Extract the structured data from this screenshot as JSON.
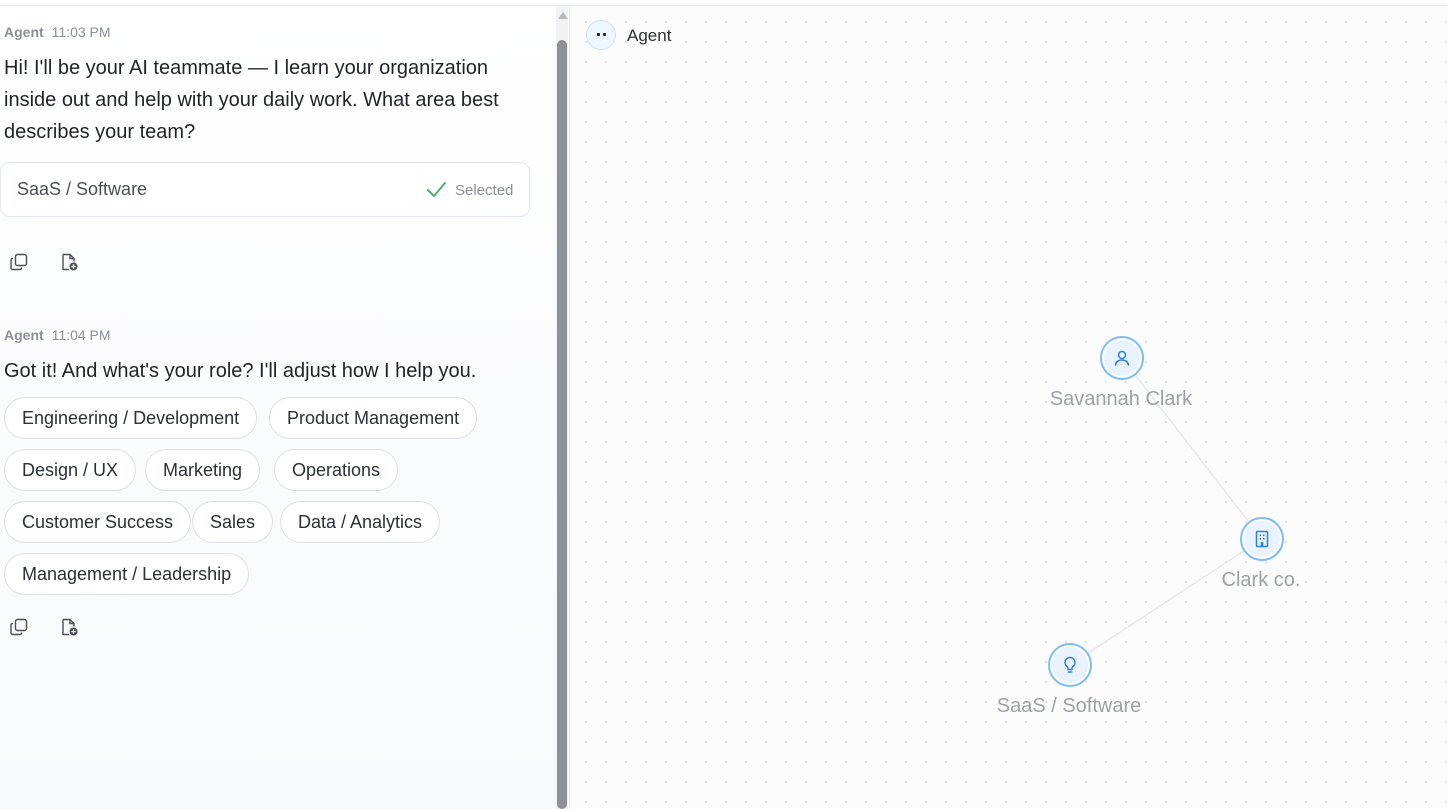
{
  "chat": {
    "messages": [
      {
        "author": "Agent",
        "time": "11:03 PM",
        "text": "Hi! I'll be your AI teammate — I learn your organization inside out and help with your daily work. What area best describes your team?",
        "selection": {
          "label": "SaaS / Software",
          "state": "Selected"
        }
      },
      {
        "author": "Agent",
        "time": "11:04 PM",
        "text": "Got it! And what's your role? I'll adjust how I help you.",
        "options": [
          "Engineering / Development",
          "Product Management",
          "Design / UX",
          "Marketing",
          "Operations",
          "Customer Success",
          "Sales",
          "Data / Analytics",
          "Management / Leadership"
        ]
      }
    ],
    "actions": {
      "copy_icon": "copy-icon",
      "save_icon": "save-to-file-icon"
    }
  },
  "graph": {
    "header": {
      "title": "Agent",
      "avatar_icon": "agent-avatar-icon"
    },
    "nodes": [
      {
        "label": "Savannah Clark",
        "icon": "user-icon"
      },
      {
        "label": "Clark co.",
        "icon": "building-icon"
      },
      {
        "label": "SaaS / Software",
        "icon": "lightbulb-icon"
      }
    ],
    "edges": [
      [
        "Savannah Clark",
        "Clark co."
      ],
      [
        "Clark co.",
        "SaaS / Software"
      ]
    ]
  },
  "colors": {
    "accent": "#7fbcf2",
    "check": "#4caf6a",
    "node_fill": "#e8f3ff"
  }
}
